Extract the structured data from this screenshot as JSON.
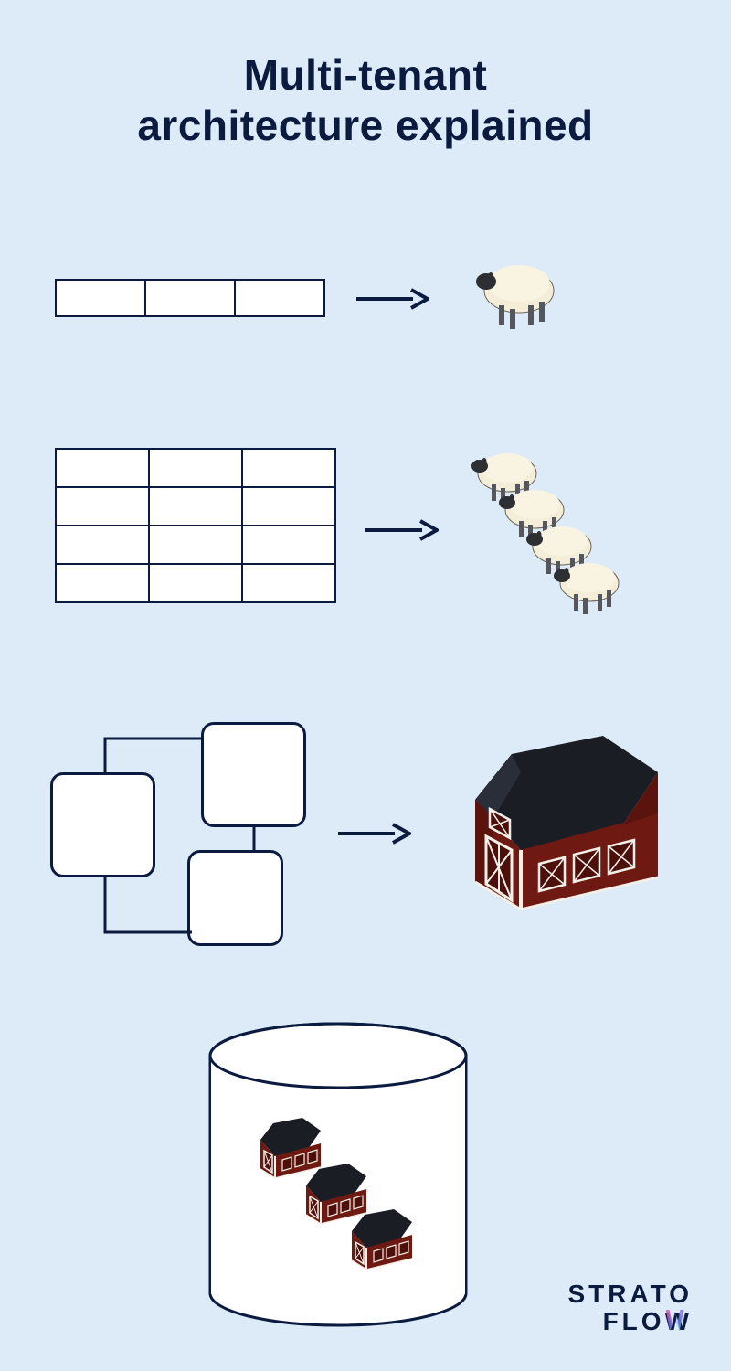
{
  "title_line1": "Multi-tenant",
  "title_line2": "architecture explained",
  "rows": {
    "single_row": {
      "columns": 3,
      "rows": 1
    },
    "table": {
      "columns": 3,
      "rows": 4
    },
    "schema": {
      "boxes": 3
    },
    "database": {
      "barns_inside": 3
    }
  },
  "logo": {
    "line1": "STRATO",
    "line2_prefix": "FLO",
    "line2_w": "W"
  },
  "colors": {
    "line": "#0b1b3f",
    "bg": "#dcebf7",
    "barn_red": "#6e1a12",
    "barn_roof": "#12151c",
    "sheep_body": "#f4edd8",
    "sheep_face": "#2d2f33"
  }
}
